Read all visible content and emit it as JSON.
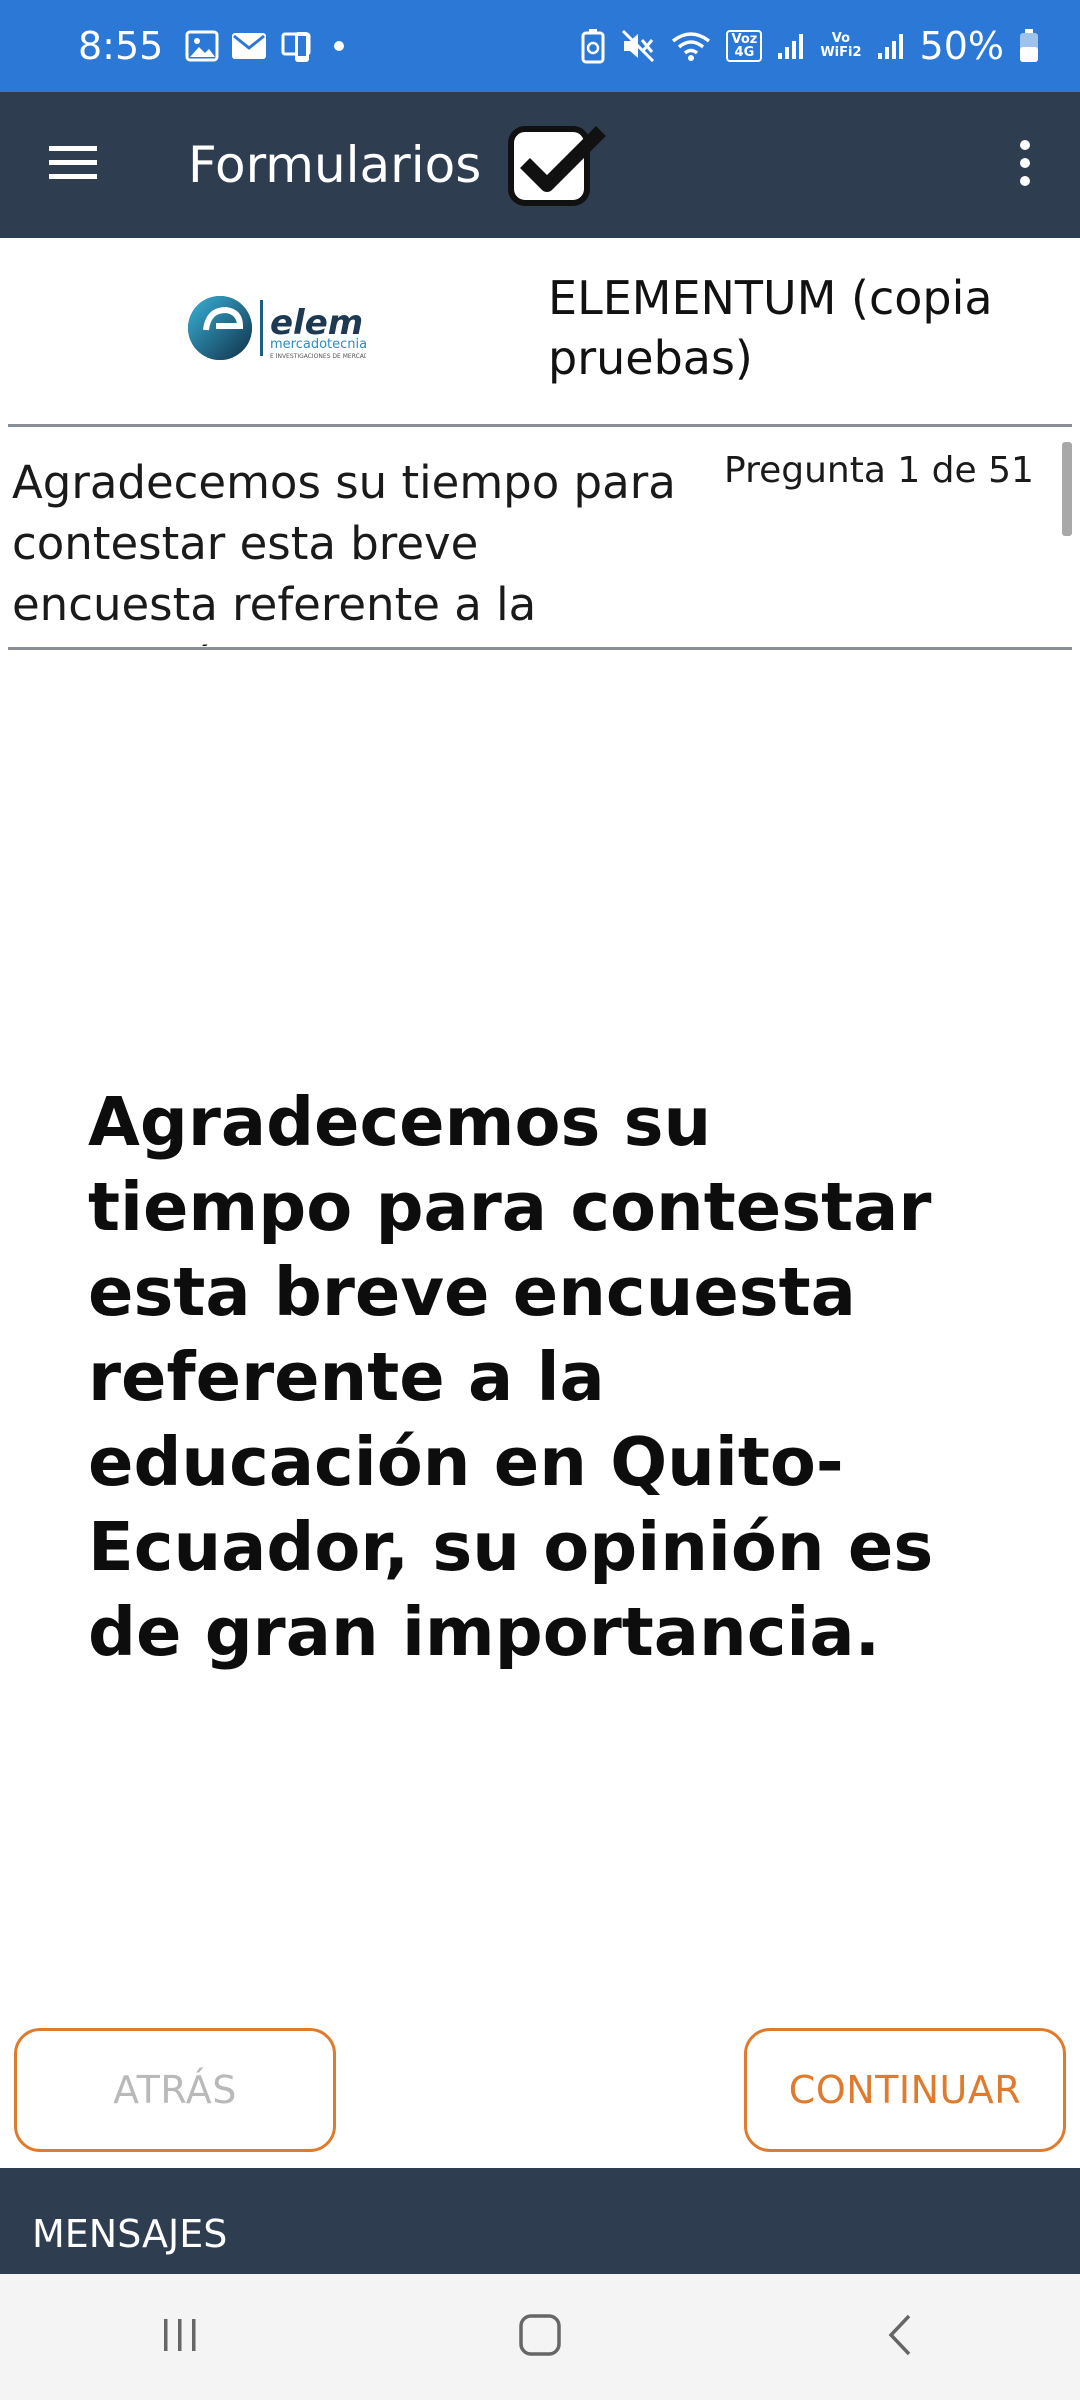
{
  "status_bar": {
    "time": "8:55",
    "battery": "50%",
    "volte_badge": "Voz\n4G",
    "wifi_calling_badge": "Vo\nWiFi2",
    "icons": [
      "gallery-icon",
      "mail-icon",
      "phone-sync-icon",
      "dot-icon",
      "battery-saver-icon",
      "mute-icon",
      "wifi-icon",
      "signal-icon",
      "battery-icon"
    ]
  },
  "app_bar": {
    "title": "Formularios",
    "icons": [
      "menu-icon",
      "checkbox-check-icon",
      "overflow-menu-icon"
    ]
  },
  "form": {
    "logo_text": "elem",
    "logo_subtext": "mercadotecnia",
    "name": "ELEMENTUM (copia pruebas)"
  },
  "question": {
    "preview": "Agradecemos su tiempo para contestar esta breve encuesta referente a la educación en",
    "counter": "Pregunta 1 de 51",
    "body": "Agradecemos su tiempo para contestar esta breve encuesta referente a la educación en Quito-Ecuador, su opinión es de gran importancia."
  },
  "buttons": {
    "back": "ATRÁS",
    "continue": "CONTINUAR"
  },
  "messages": {
    "label": "MENSAJES"
  },
  "nav_bar": {
    "icons": [
      "recent-apps-icon",
      "home-icon",
      "back-icon"
    ]
  },
  "colors": {
    "status_bar": "#2c78d6",
    "app_bar": "#2e3d4f",
    "accent": "#e07a2d",
    "disabled_text": "#b9b9b9"
  }
}
